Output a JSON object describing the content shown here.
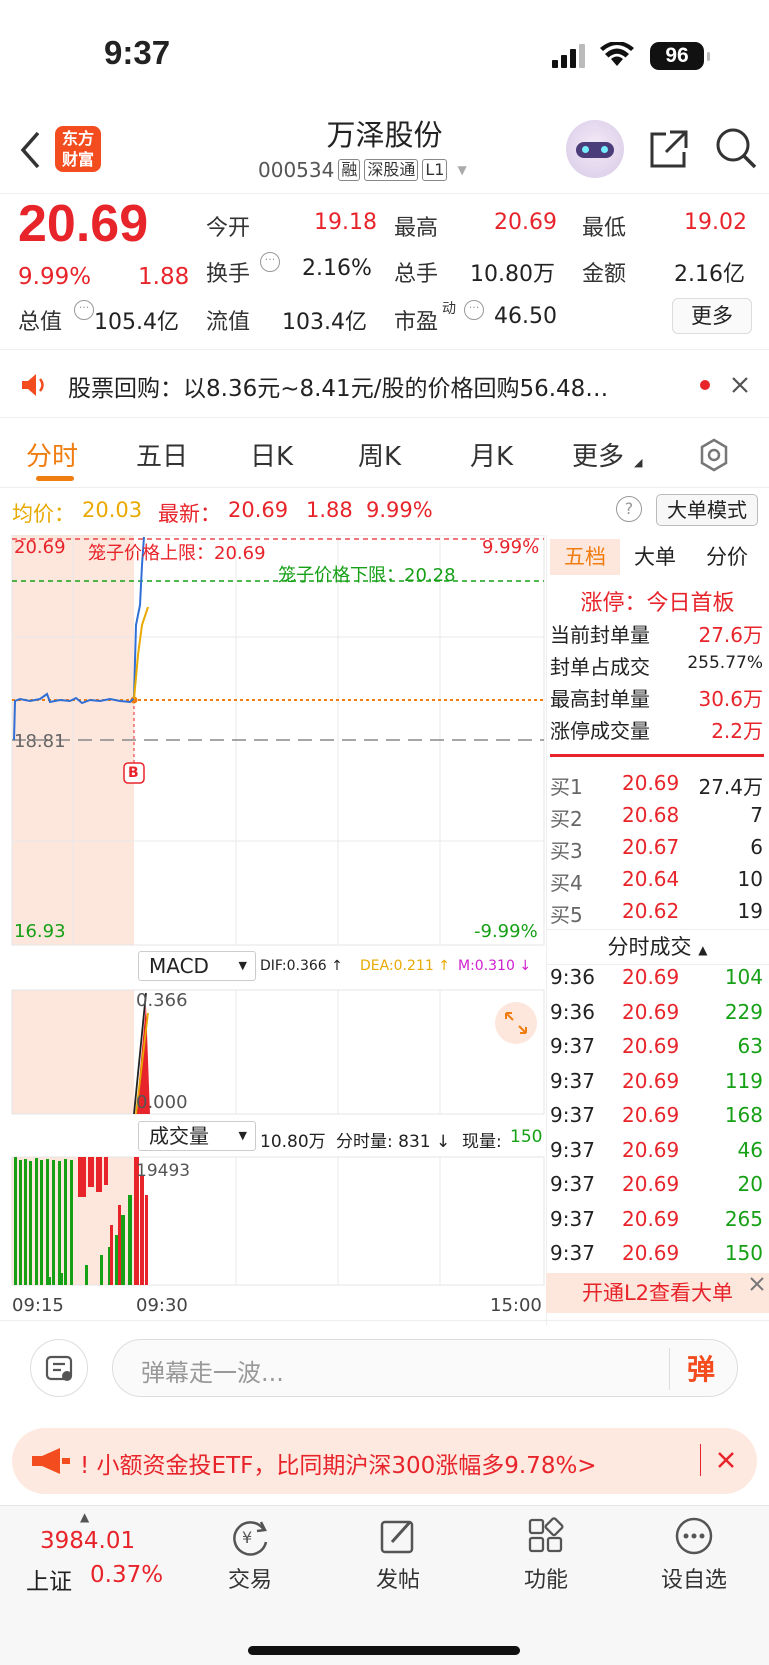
{
  "status_bar": {
    "time": "9:37",
    "battery": "96"
  },
  "header": {
    "logo_line1": "东方",
    "logo_line2": "财富",
    "title": "万泽股份",
    "code": "000534",
    "tags": [
      "融",
      "深股通",
      "L1"
    ]
  },
  "quote": {
    "price": "20.69",
    "change_pct": "9.99%",
    "change": "1.88",
    "stats": [
      {
        "label": "今开",
        "value": "19.18"
      },
      {
        "label": "最高",
        "value": "20.69"
      },
      {
        "label": "最低",
        "value": "19.02"
      },
      {
        "label": "换手",
        "value": "2.16%"
      },
      {
        "label": "总手",
        "value": "10.80万"
      },
      {
        "label": "金额",
        "value": "2.16亿"
      },
      {
        "label": "总值",
        "value": "105.4亿"
      },
      {
        "label": "流值",
        "value": "103.4亿"
      },
      {
        "label": "市盈",
        "value": "46.50"
      }
    ],
    "pe_sup": "动",
    "more_button": "更多"
  },
  "announcement": "股票回购：以8.36元~8.41元/股的价格回购56.48…",
  "chart_tabs": [
    "分时",
    "五日",
    "日K",
    "周K",
    "月K",
    "更多"
  ],
  "info": {
    "avg_label": "均价：",
    "avg": "20.03",
    "latest_label": "最新：",
    "latest": "20.69",
    "change": "1.88",
    "pct": "9.99%",
    "mode_button": "大单模式"
  },
  "price_chart": {
    "upper_price": "20.69",
    "lower_price": "16.93",
    "prev_close": "18.81",
    "upper_pct": "9.99%",
    "lower_pct": "-9.99%",
    "cage_upper": "笼子价格上限：20.69",
    "cage_lower": "笼子价格下限：20.28",
    "buy_marker": "B"
  },
  "macd": {
    "label": "MACD",
    "dif": "DIF:0.366 ↑",
    "dea": "DEA:0.211 ↑",
    "m": "M:0.310 ↓",
    "top": "0.366",
    "bottom": "0.000"
  },
  "volume": {
    "label": "成交量",
    "total": "10.80万",
    "period_label": "分时量: 831 ↓",
    "now_label": "现量:",
    "now": "150",
    "max": "19493",
    "times": [
      "09:15",
      "09:30",
      "15:00"
    ]
  },
  "right_panel": {
    "tabs": [
      "五档",
      "大单",
      "分价"
    ],
    "limit_title": "涨停：今日首板",
    "seal_rows": [
      {
        "label": "当前封单量",
        "value": "27.6万"
      },
      {
        "label": "封单占成交",
        "value": "255.77%"
      },
      {
        "label": "最高封单量",
        "value": "30.6万"
      },
      {
        "label": "涨停成交量",
        "value": "2.2万"
      }
    ],
    "bids": [
      {
        "label": "买1",
        "price": "20.69",
        "vol": "27.4万"
      },
      {
        "label": "买2",
        "price": "20.68",
        "vol": "7"
      },
      {
        "label": "买3",
        "price": "20.67",
        "vol": "6"
      },
      {
        "label": "买4",
        "price": "20.64",
        "vol": "10"
      },
      {
        "label": "买5",
        "price": "20.62",
        "vol": "19"
      }
    ],
    "ticks_title": "分时成交",
    "ticks": [
      {
        "t": "9:36",
        "p": "20.69",
        "v": "104"
      },
      {
        "t": "9:36",
        "p": "20.69",
        "v": "229"
      },
      {
        "t": "9:37",
        "p": "20.69",
        "v": "63"
      },
      {
        "t": "9:37",
        "p": "20.69",
        "v": "119"
      },
      {
        "t": "9:37",
        "p": "20.69",
        "v": "168"
      },
      {
        "t": "9:37",
        "p": "20.69",
        "v": "46"
      },
      {
        "t": "9:37",
        "p": "20.69",
        "v": "20"
      },
      {
        "t": "9:37",
        "p": "20.69",
        "v": "265"
      },
      {
        "t": "9:37",
        "p": "20.69",
        "v": "150"
      }
    ],
    "l2_promo": "开通L2查看大单"
  },
  "comment": {
    "placeholder": "弹幕走一波...",
    "danmaku": "弹"
  },
  "promo": "!  小额资金投ETF，比同期沪深300涨幅多9.78%>",
  "bottom": {
    "index_value": "3984.01",
    "index_name": "上证",
    "index_pct": "0.37%",
    "nav": [
      "交易",
      "发帖",
      "功能",
      "设自选"
    ]
  },
  "colors": {
    "up": "#e8242b",
    "down": "#16a016",
    "accent": "#f07d10"
  }
}
